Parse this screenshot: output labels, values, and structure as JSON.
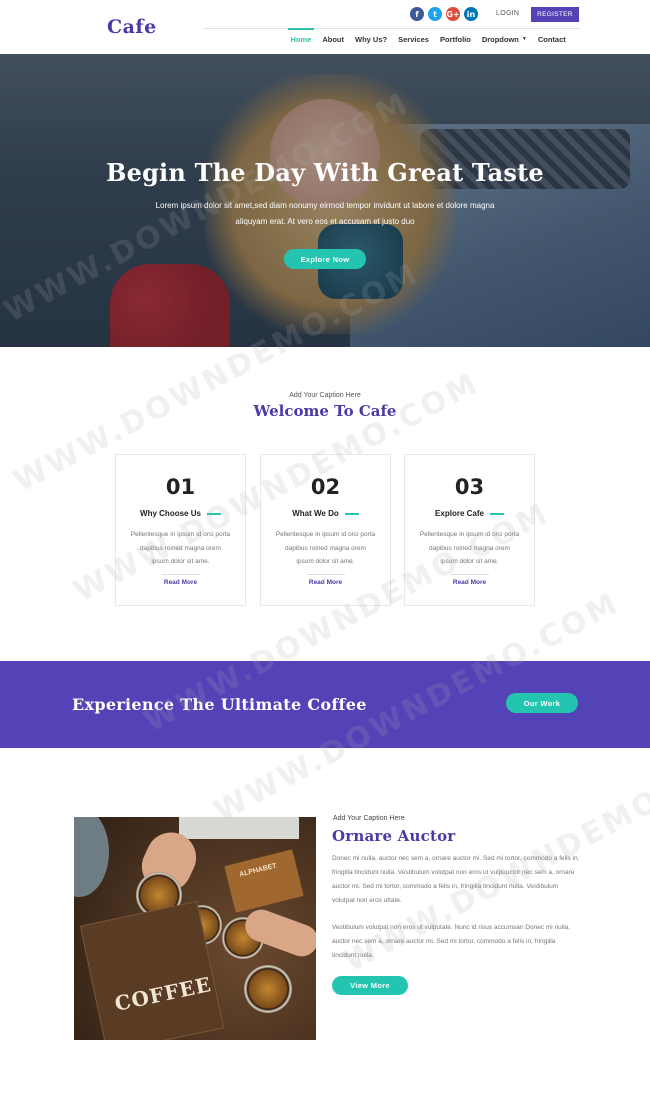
{
  "header": {
    "logo": "Cafe",
    "social": [
      {
        "icon": "facebook-icon",
        "glyph": "f"
      },
      {
        "icon": "twitter-icon",
        "glyph": "t"
      },
      {
        "icon": "google-plus-icon",
        "glyph": "G+"
      },
      {
        "icon": "linkedin-icon",
        "glyph": "in"
      }
    ],
    "login_label": "LOGIN",
    "register_label": "REGISTER",
    "nav": [
      {
        "label": "Home",
        "active": true
      },
      {
        "label": "About"
      },
      {
        "label": "Why Us?"
      },
      {
        "label": "Services"
      },
      {
        "label": "Portfolio"
      },
      {
        "label": "Dropdown",
        "caret": "▼"
      },
      {
        "label": "Contact"
      }
    ]
  },
  "hero": {
    "title": "Begin The Day With Great Taste",
    "text": "Lorem ipsum dolor sit amet,sed diam nonumy eirmod tempor invidunt ut labore et dolore magna aliquyam erat. At vero eos et accusam et justo duo",
    "button_label": "Explore Now"
  },
  "welcome": {
    "caption": "Add Your Caption Here",
    "title": "Welcome To Cafe",
    "cards": [
      {
        "number": "01",
        "title": "Why Choose Us",
        "text": "Pellentesque in ipsum id orci porta dapibus roined magna orem ipsum dolor sit ame.",
        "link": "Read More"
      },
      {
        "number": "02",
        "title": "What We Do",
        "text": "Pellentesque in ipsum id orci porta dapibus roined magna orem ipsum dolor sit ame.",
        "link": "Read More"
      },
      {
        "number": "03",
        "title": "Explore Cafe",
        "text": "Pellentesque in ipsum id orci porta dapibus roined magna orem ipsum dolor sit ame.",
        "link": "Read More"
      }
    ]
  },
  "banner": {
    "title": "Experience The Ultimate Coffee",
    "button_label": "Our Work"
  },
  "about": {
    "caption": "Add Your Caption Here",
    "title": "Ornare Auctor",
    "paragraph1": "Donec mi nulla, auctor nec sem a, ornare auctor mi. Sed mi tortor, commodo a felis in, fringilla tincidunt nulla. Vestibulum volutpat non eros ut vulpuuctor nec sem a, ornare auctor mi. Sed mi tortor, commodo a felis in, fringilla tincidunt nulla. Vestibulum volutpat non eros uttate.",
    "paragraph2": "Vestibulum volutpat non eros ut vulputate. Nunc id risus accumsan Donec mi nulla, auctor nec sem a, ornare auctor mi. Sed mi tortor, commodo a felis in, fringilla tincidunt nulla.",
    "button_label": "View More",
    "photo_texts": {
      "bag": "COFFEE",
      "card": "ALPHABET"
    }
  },
  "watermark": "WWW.DOWNDEMO.COM",
  "colors": {
    "brand_purple": "#5443b7",
    "heading_purple": "#4b3aa6",
    "accent_teal": "#23c5b0"
  }
}
